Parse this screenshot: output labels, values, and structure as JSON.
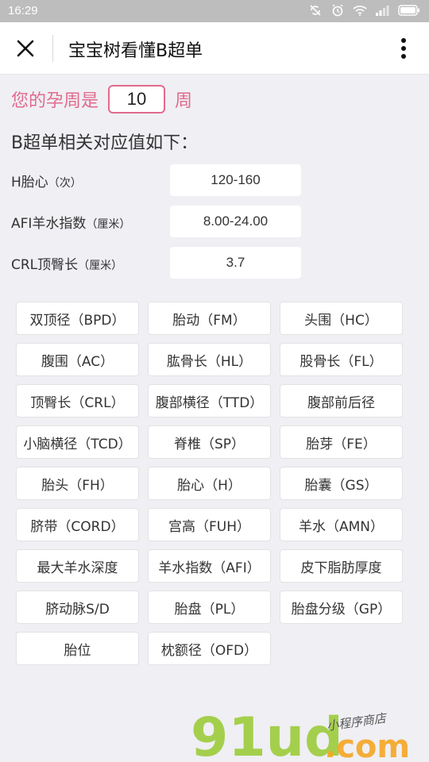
{
  "status_bar": {
    "time": "16:29"
  },
  "nav": {
    "title": "宝宝树看懂B超单"
  },
  "week": {
    "prefix": "您的孕周是",
    "value": "10",
    "suffix": "周"
  },
  "section_title": "B超单相关对应值如下：",
  "values": [
    {
      "label": "H胎心",
      "unit": "（次）",
      "value": "120-160"
    },
    {
      "label": "AFI羊水指数",
      "unit": "（厘米）",
      "value": "8.00-24.00"
    },
    {
      "label": "CRL顶臀长",
      "unit": "（厘米）",
      "value": "3.7"
    }
  ],
  "buttons": [
    "双顶径（BPD）",
    "胎动（FM）",
    "头围（HC）",
    "腹围（AC）",
    "肱骨长（HL）",
    "股骨长（FL）",
    "顶臀长（CRL）",
    "腹部横径（TTD）",
    "腹部前后径",
    "小脑横径（TCD）",
    "脊椎（SP）",
    "胎芽（FE）",
    "胎头（FH）",
    "胎心（H）",
    "胎囊（GS）",
    "脐带（CORD）",
    "宫高（FUH）",
    "羊水（AMN）",
    "最大羊水深度",
    "羊水指数（AFI）",
    "皮下脂肪厚度",
    "脐动脉S/D",
    "胎盘（PL）",
    "胎盘分级（GP）",
    "胎位",
    "枕额径（OFD）"
  ],
  "watermark": {
    "logo": "91ud.com",
    "tagline": "小程序商店"
  },
  "colors": {
    "accent": "#e26a8c",
    "background": "#efeff4",
    "status_bar": "#bdbdbd",
    "logo_green": "#9ccc3a",
    "logo_orange": "#f5a623"
  },
  "icons": [
    "close-icon",
    "more-vertical-icon",
    "wifi-icon",
    "alarm-icon",
    "signal-icon",
    "battery-icon"
  ]
}
